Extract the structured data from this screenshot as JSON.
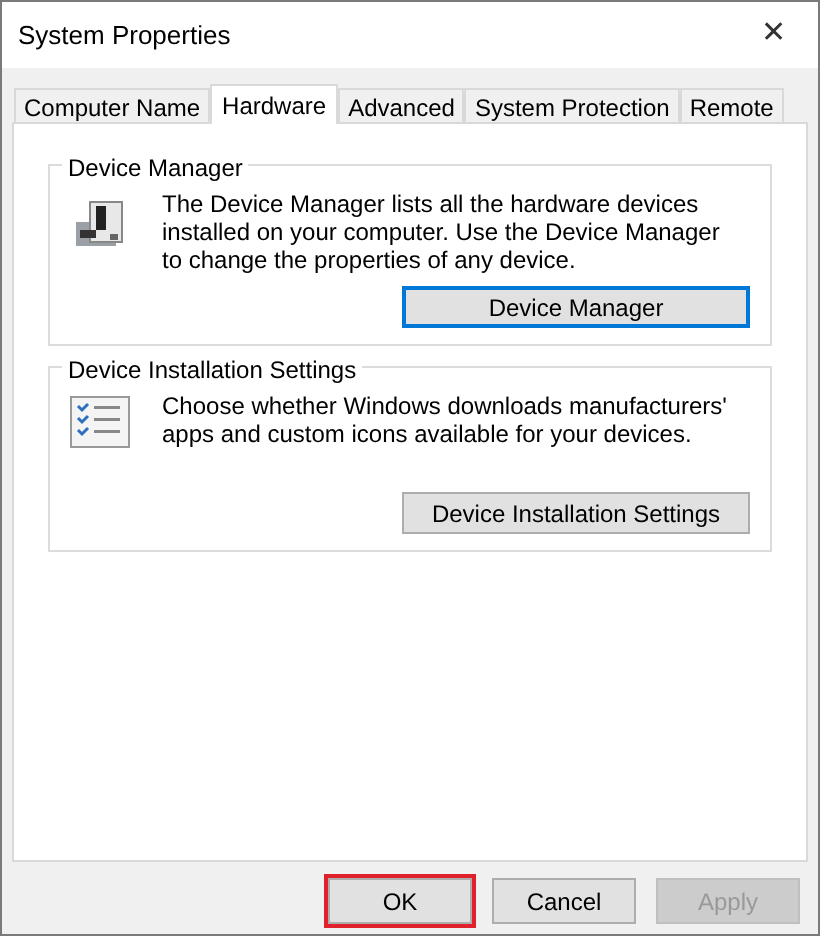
{
  "window": {
    "title": "System Properties",
    "close": "✕"
  },
  "tabs": [
    {
      "label": "Computer Name",
      "selected": false
    },
    {
      "label": "Hardware",
      "selected": true
    },
    {
      "label": "Advanced",
      "selected": false
    },
    {
      "label": "System Protection",
      "selected": false
    },
    {
      "label": "Remote",
      "selected": false
    }
  ],
  "groups": [
    {
      "kind": "device",
      "title": "Device Manager",
      "text": "The Device Manager lists all the hardware devices installed on your computer. Use the Device Manager to change the properties of any device.",
      "button": {
        "label": "Device Manager",
        "focused": true
      }
    },
    {
      "kind": "checklist",
      "title": "Device Installation Settings",
      "text": "Choose whether Windows downloads manufacturers' apps and custom icons available for your devices.",
      "button": {
        "label": "Device Installation Settings",
        "focused": false
      }
    }
  ],
  "buttons": [
    {
      "label": "OK",
      "highlighted": true,
      "disabled": false
    },
    {
      "label": "Cancel",
      "highlighted": false,
      "disabled": false
    },
    {
      "label": "Apply",
      "highlighted": false,
      "disabled": true
    }
  ]
}
